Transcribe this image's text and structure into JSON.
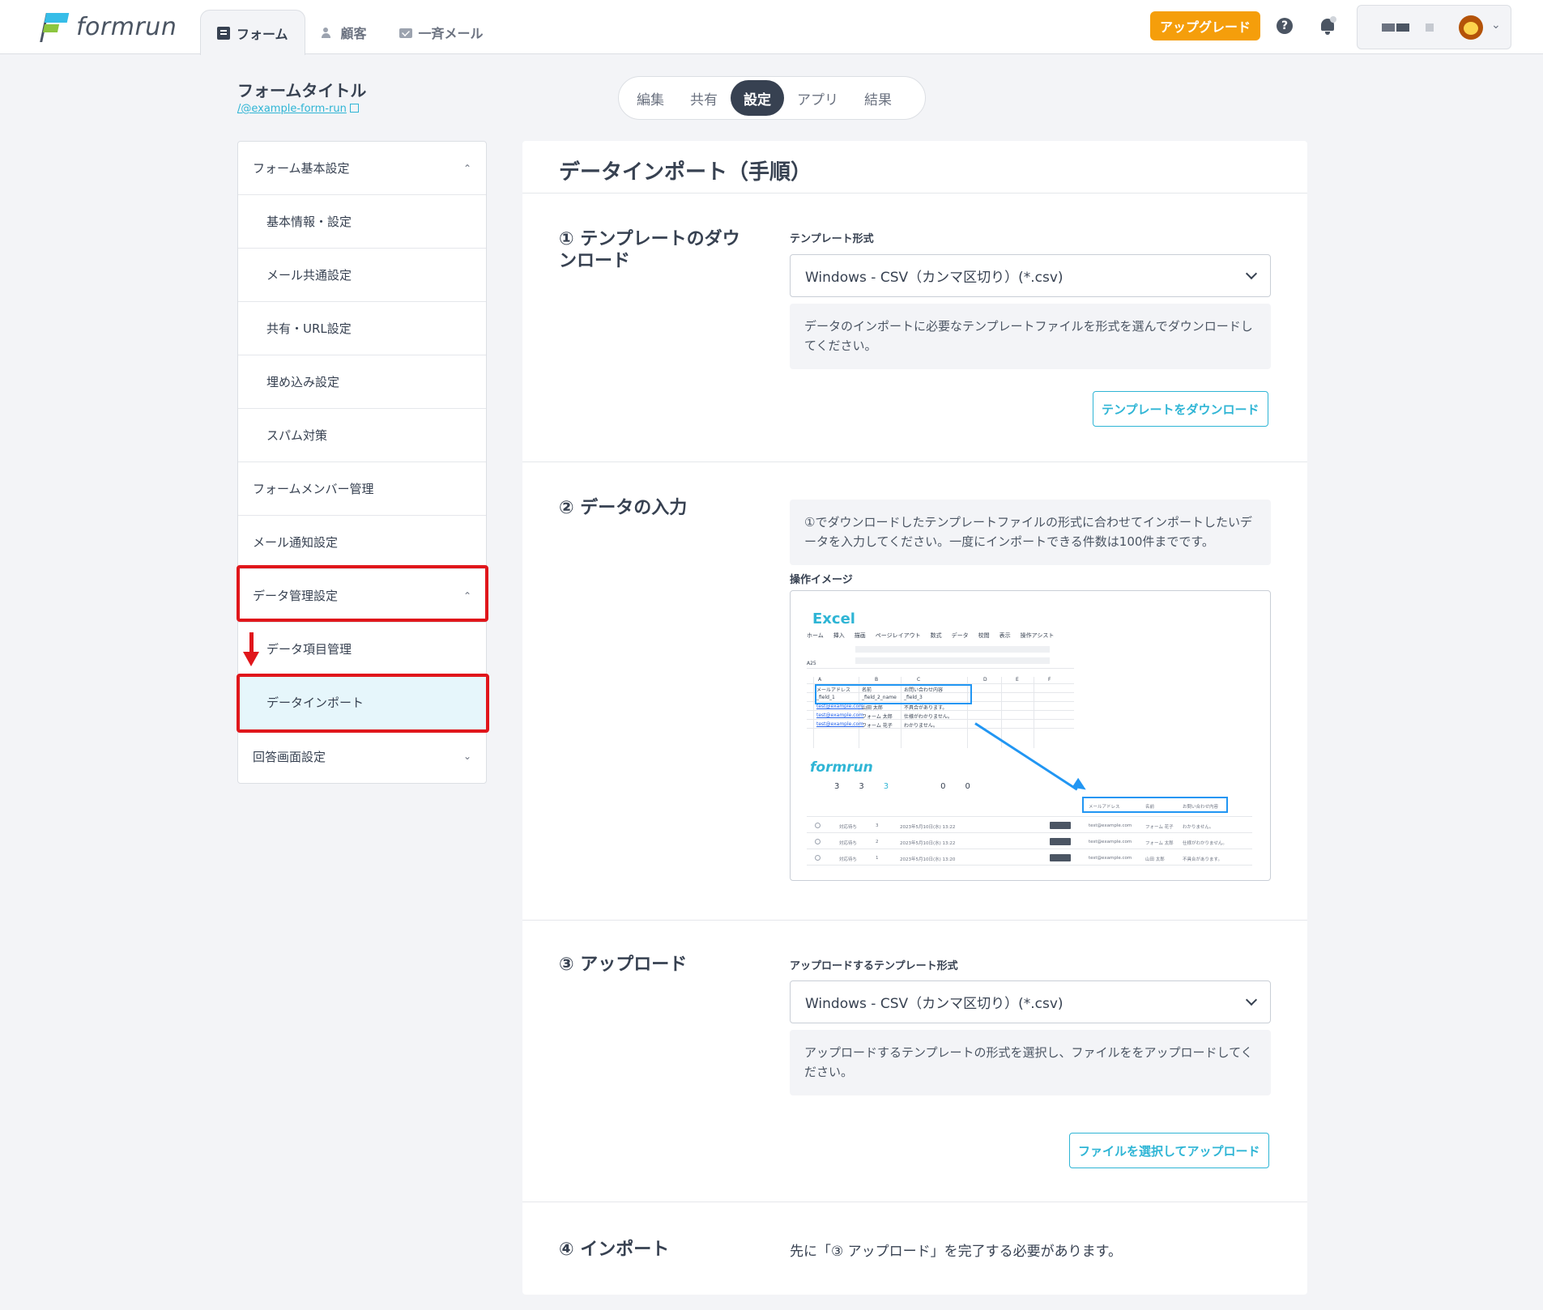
{
  "header": {
    "logo_text": "formrun",
    "nav": [
      {
        "label": "フォーム",
        "icon": "form-icon",
        "active": true
      },
      {
        "label": "顧客",
        "icon": "people-icon",
        "active": false
      },
      {
        "label": "一斉メール",
        "icon": "mail-icon",
        "active": false
      }
    ],
    "upgrade_label": "アップグレード",
    "help_glyph": "?",
    "account_chevron": "⌄"
  },
  "form": {
    "title": "フォームタイトル",
    "link": "/@example-form-run"
  },
  "seg_tabs": [
    {
      "label": "編集",
      "active": false
    },
    {
      "label": "共有",
      "active": false
    },
    {
      "label": "設定",
      "active": true
    },
    {
      "label": "アプリ",
      "active": false
    },
    {
      "label": "結果",
      "active": false
    }
  ],
  "sidebar": {
    "items": [
      {
        "label": "フォーム基本設定",
        "chevron": "⌃"
      },
      {
        "label": "基本情報・設定"
      },
      {
        "label": "メール共通設定"
      },
      {
        "label": "共有・URL設定"
      },
      {
        "label": "埋め込み設定"
      },
      {
        "label": "スパム対策"
      },
      {
        "label": "フォームメンバー管理"
      },
      {
        "label": "メール通知設定"
      },
      {
        "label": "データ管理設定",
        "chevron": "⌃"
      },
      {
        "label": "データ項目管理"
      },
      {
        "label": "データインポート"
      },
      {
        "label": "回答画面設定",
        "chevron": "⌄"
      }
    ]
  },
  "main": {
    "title": "データインポート（手順）",
    "step1": {
      "title": "① テンプレートのダウンロード",
      "label": "テンプレート形式",
      "select_value": "Windows - CSV（カンマ区切り）(*.csv)",
      "note": "データのインポートに必要なテンプレートファイルを形式を選んでダウンロードしてください。",
      "button": "テンプレートをダウンロード"
    },
    "step2": {
      "title": "② データの入力",
      "note": "①でダウンロードしたテンプレートファイルの形式に合わせてインポートしたいデータを入力してください。一度にインポートできる件数は100件までです。",
      "image_label": "操作イメージ"
    },
    "step3": {
      "title": "③ アップロード",
      "label": "アップロードするテンプレート形式",
      "select_value": "Windows - CSV（カンマ区切り）(*.csv)",
      "note": "アップロードするテンプレートの形式を選択し、ファイルををアップロードしてください。",
      "button": "ファイルを選択してアップロード"
    },
    "step4": {
      "title": "④ インポート",
      "text": "先に「③ アップロード」を完了する必要があります。"
    }
  },
  "op_image": {
    "excel_title": "Excel",
    "excel_menu": [
      "ホーム",
      "挿入",
      "描画",
      "ページレイアウト",
      "数式",
      "データ",
      "校閲",
      "表示",
      "操作アシスト"
    ],
    "cell_ref": "A25",
    "columns": [
      "A",
      "B",
      "C",
      "D",
      "E",
      "F"
    ],
    "rows": [
      [
        "メールアドレス",
        "名前",
        "お問い合わせ内容"
      ],
      [
        "_field_1",
        "_field_2_name",
        "_field_3"
      ],
      [
        "test@example.com",
        "山田 太郎",
        "不具合があります。"
      ],
      [
        "test@example.com",
        "フォーム 太郎",
        "仕様がわかりません。"
      ],
      [
        "test@example.com",
        "フォーム 花子",
        "わかりません。"
      ]
    ],
    "formrun_logo": "formrun",
    "stats": [
      "3",
      "3",
      "3",
      "0",
      "0"
    ],
    "list_headers": [
      "メールアドレス",
      "名前",
      "お問い合わせ内容"
    ],
    "list_rows": [
      [
        "対応待ち",
        "3",
        "2023年5月10日(水) 13:22",
        "test@example.com",
        "フォーム 花子",
        "わかりません。"
      ],
      [
        "対応待ち",
        "2",
        "2023年5月10日(水) 13:22",
        "test@example.com",
        "フォーム 太郎",
        "仕様がわかりません。"
      ],
      [
        "対応待ち",
        "1",
        "2023年5月10日(水) 13:20",
        "test@example.com",
        "山田 太郎",
        "不具合があります。"
      ]
    ]
  },
  "colors": {
    "accent": "#2fb5d5",
    "upgrade": "#f59e0b",
    "highlight": "#e0161b",
    "dark": "#374151"
  }
}
